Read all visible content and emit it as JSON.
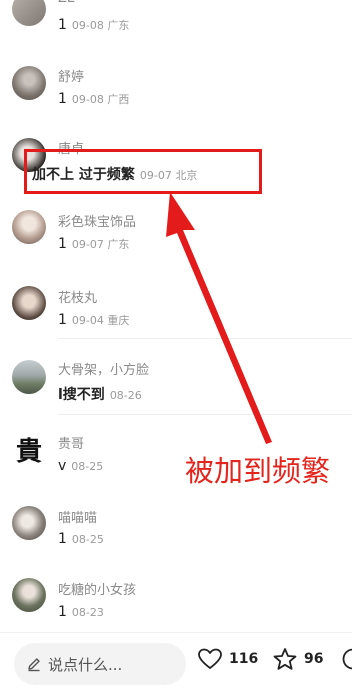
{
  "comments": [
    {
      "name": "ZE",
      "text": "1",
      "meta": "09-08 广东"
    },
    {
      "name": "舒婷",
      "text": "1",
      "meta": "09-08 广西"
    },
    {
      "name": "唐卓",
      "text": "加不上 过于频繁",
      "meta": "09-07 北京"
    },
    {
      "name": "彩色珠宝饰品",
      "text": "1",
      "meta": "09-07 广东"
    },
    {
      "name": "花枝丸",
      "text": "1",
      "meta": "09-04 重庆"
    },
    {
      "name": "大骨架，小方脸",
      "text": "l搜不到",
      "meta": "08-26"
    },
    {
      "name": "贵哥",
      "text": "v",
      "meta": "08-25"
    },
    {
      "name": "喵喵喵",
      "text": "1",
      "meta": "08-25"
    },
    {
      "name": "吃糖的小女孩",
      "text": "1",
      "meta": "08-23"
    }
  ],
  "calligraphy_avatar_char": "貴",
  "annotation": "被加到频繁",
  "bottom_bar": {
    "input_placeholder": "说点什么...",
    "like_count": "116",
    "star_count": "96"
  },
  "colors": {
    "highlight": "#e31b1b",
    "annotation_text": "#e3251d"
  }
}
